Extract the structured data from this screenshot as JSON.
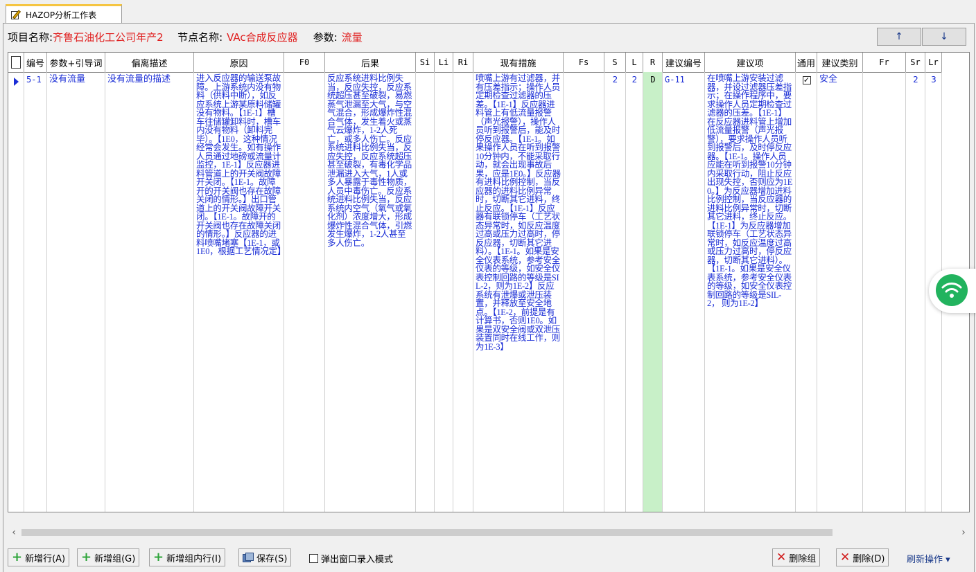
{
  "tab": {
    "title": "HAZOP分析工作表"
  },
  "info": {
    "project_label": "项目名称:",
    "project_value": "齐鲁石油化工公司年产2",
    "node_label": "节点名称:",
    "node_value": "VAc合成反应器",
    "param_label": "参数:",
    "param_value": "流量"
  },
  "nav": {
    "up": "↑",
    "down": "↓"
  },
  "columns": [
    "编号",
    "参数+引导词",
    "偏离描述",
    "原因",
    "F0",
    "后果",
    "Si",
    "Li",
    "Ri",
    "现有措施",
    "Fs",
    "S",
    "L",
    "R",
    "建议编号",
    "建议项",
    "通用",
    "建议类别",
    "Fr",
    "Sr",
    "Lr"
  ],
  "row": {
    "id": "5-1",
    "param": "没有流量",
    "deviation": "没有流量的描述",
    "cause": "进入反应器的输送泵故障。上游系统内没有物料（供料中断），如反应系统上游某原料储罐没有物料。【1E-1】槽车往储罐卸料时，槽车内没有物料（卸料完毕）。【1E0，这种情况经常会发生。如有操作人员通过地磅或流量计监控，1E-1】反应器进料管道上的开关阀故障开关闭。【1E-1。故障开的开关阀也存在故障关闭的情形。】出口管道上的开关阀故障开关闭。【1E-1。故障开的开关阀也存在故障关闭的情形。】反应器的进料喷嘴堵塞【1E-1，或1E0，根据工艺情况定】",
    "f0": "",
    "consequence": "反应系统进料比例失当，反应失控，反应系统超压甚至破裂，易燃蒸气泄漏至大气，与空气混合，形成爆炸性混合气体，发生着火或蒸气云爆炸，1-2人死亡，或多人伤亡。反应系统进料比例失当，反应失控，反应系统超压甚至破裂，有毒化学品泄漏进入大气，1人或多人暴露于毒性物质，人员中毒伤亡。反应系统进料比例失当，反应系统内空气（氧气或氧化剂）浓度增大，形成爆炸性混合气体，引燃发生爆炸，1-2人甚至多人伤亡。",
    "si": "",
    "li": "",
    "ri": "",
    "measures": "喷嘴上游有过滤器，并有压差指示；操作人员定期检查过滤器的压差。【1E-1】反应器进料管上有低流量报警（声光报警），操作人员听到报警后，能及时停反应器。【1E-1。如果操作人员在听到报警10分钟内，不能采取行动，就会出现事故后果，应是1E0。】反应器有进料比例控制，当反应器的进料比例异常时，切断其它进料，终止反应。【1E-1】反应器有联锁停车（工艺状态异常时，如反应温度过高或压力过高时，停反应器，切断其它进料）。【1E-1。如果是安全仪表系统，参考安全仪表的等级，如安全仪表控制回路的等级是SIL-2，则为1E-2】反应系统有泄爆或泄压装置，并释放至安全地点。【1E-2，前提是有计算书，否则1E0。如果是双安全阀或双泄压装置同时在线工作，则为1E-3】",
    "fs": "",
    "s": "2",
    "l": "2",
    "r": "D",
    "rec_id": "G-11",
    "recommendation": "在喷嘴上游安装过滤器，并设过滤器压差指示；在操作程序中，要求操作人员定期检查过滤器的压差。【1E-1】在反应器进料管上增加低流量报警（声光报警），要求操作人员听到报警后，及时停反应器。【1E-1。操作人员应能在听到报警10分钟内采取行动，阻止反应出现失控，否则应为1E0。】为反应器增加进料比例控制，当反应器的进料比例异常时，切断其它进料，终止反应。【1E-1】为反应器增加联锁停车（工艺状态异常时，如反应温度过高或压力过高时，停反应器，切断其它进料）。【1E-1。如果是安全仪表系统，参考安全仪表的等级，如安全仪表控制回路的等级是SIL-2， 则为1E-2】",
    "general_checked": true,
    "general_mark": "✓",
    "category": "安全",
    "fr": "",
    "sr": "2",
    "lr": "3"
  },
  "scroll": {
    "left": "‹",
    "right": "›"
  },
  "toolbar": {
    "add_row": "新增行(A)",
    "add_group": "新增组(G)",
    "add_group_row": "新增组内行(I)",
    "save": "保存(S)",
    "popup_mode": "弹出窗口录入模式",
    "delete_group": "删除组",
    "delete": "删除(D)",
    "refresh": "刷新操作 ▾"
  },
  "icons": {
    "plus": "+",
    "x": "✕",
    "row_pointer": "triangle-right"
  },
  "colors": {
    "accent_red": "#e02020",
    "cell_text": "#1a2dd6",
    "r_cell_bg": "#c8f0c8",
    "tab_accent": "#f5c542"
  }
}
